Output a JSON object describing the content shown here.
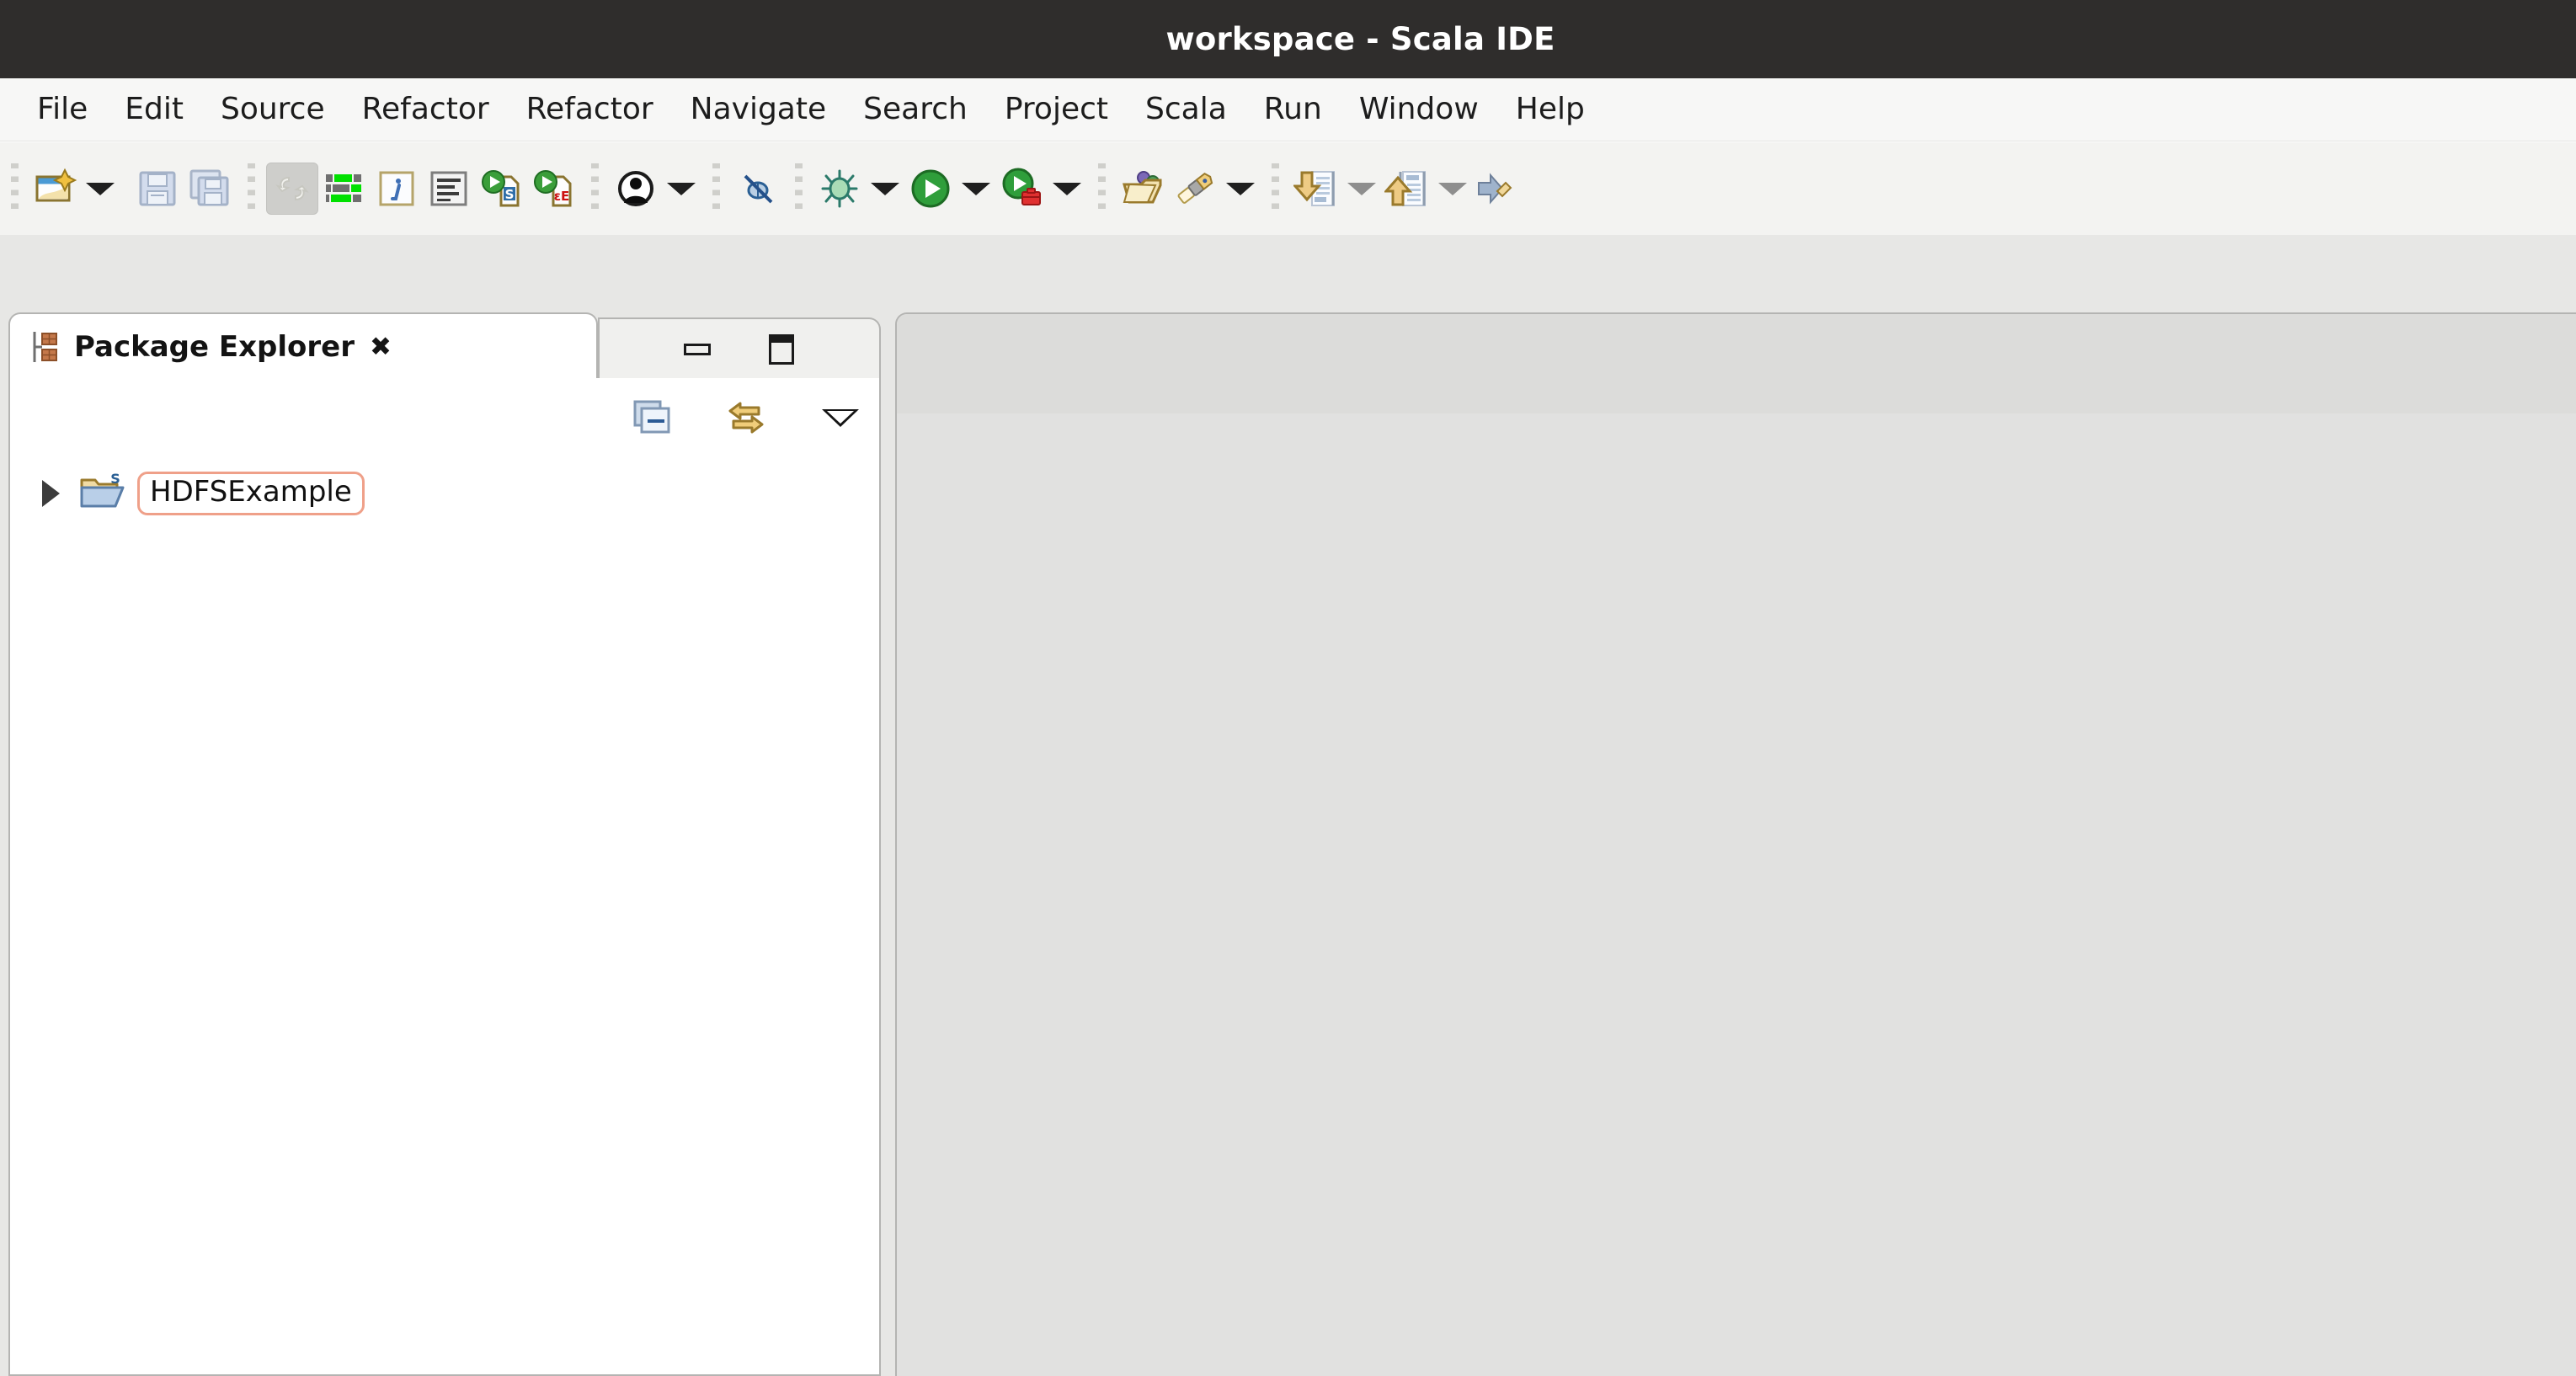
{
  "window": {
    "title": "workspace - Scala IDE"
  },
  "menubar": {
    "items": [
      {
        "label": "File",
        "name": "menu-file"
      },
      {
        "label": "Edit",
        "name": "menu-edit"
      },
      {
        "label": "Source",
        "name": "menu-source"
      },
      {
        "label": "Refactor",
        "name": "menu-refactor-1"
      },
      {
        "label": "Refactor",
        "name": "menu-refactor-2"
      },
      {
        "label": "Navigate",
        "name": "menu-navigate"
      },
      {
        "label": "Search",
        "name": "menu-search"
      },
      {
        "label": "Project",
        "name": "menu-project"
      },
      {
        "label": "Scala",
        "name": "menu-scala"
      },
      {
        "label": "Run",
        "name": "menu-run"
      },
      {
        "label": "Window",
        "name": "menu-window"
      },
      {
        "label": "Help",
        "name": "menu-help"
      }
    ]
  },
  "toolbar": {
    "icons": [
      "new-wizard-icon",
      "new-wizard-dropdown-icon",
      "save-icon",
      "save-all-icon",
      "toggle-mark-occurrences-icon",
      "scala-outline-icon",
      "scala-info-icon",
      "format-source-icon",
      "run-scala-worksheet-icon",
      "run-scala-interpreter-icon",
      "open-perspective-icon",
      "open-perspective-dropdown-icon",
      "skip-all-breakpoints-icon",
      "debug-icon",
      "debug-dropdown-icon",
      "run-icon",
      "run-dropdown-icon",
      "run-external-tools-icon",
      "run-external-tools-dropdown-icon",
      "open-type-icon",
      "open-task-icon",
      "open-task-dropdown-icon",
      "previous-annotation-icon",
      "previous-annotation-dropdown-icon",
      "next-annotation-icon",
      "next-annotation-dropdown-icon",
      "last-edit-location-icon"
    ]
  },
  "package_explorer": {
    "tab_label": "Package Explorer",
    "tab_icon": "package-explorer-icon",
    "close_label": "✖",
    "minimize_title": "Minimize",
    "maximize_title": "Maximize",
    "view_toolbar": [
      {
        "name": "collapse-all-icon",
        "title": "Collapse All"
      },
      {
        "name": "link-with-editor-icon",
        "title": "Link with Editor"
      },
      {
        "name": "view-menu-icon",
        "title": "View Menu"
      }
    ],
    "tree": [
      {
        "label": "HDFSExample",
        "icon": "scala-project-folder-icon",
        "expanded": false,
        "selected": true
      }
    ]
  },
  "editor": {
    "open_tabs": [],
    "empty": true
  },
  "colors": {
    "titlebar_bg": "#2f2d2c",
    "titlebar_fg": "#ffffff",
    "menubar_bg": "#f7f7f6",
    "toolbar_bg": "#f3f3f1",
    "workbench_bg": "#e7e7e5",
    "panel_bg": "#ffffff",
    "panel_border": "#b4b4b2",
    "editor_bg": "#e1e1e0",
    "editor_tabstrip_bg": "#dcdcda",
    "selection_outline": "#efa089",
    "accent_green": "#00dd00",
    "accent_run_green": "#2c9a37",
    "accent_gold": "#e0a52a"
  }
}
